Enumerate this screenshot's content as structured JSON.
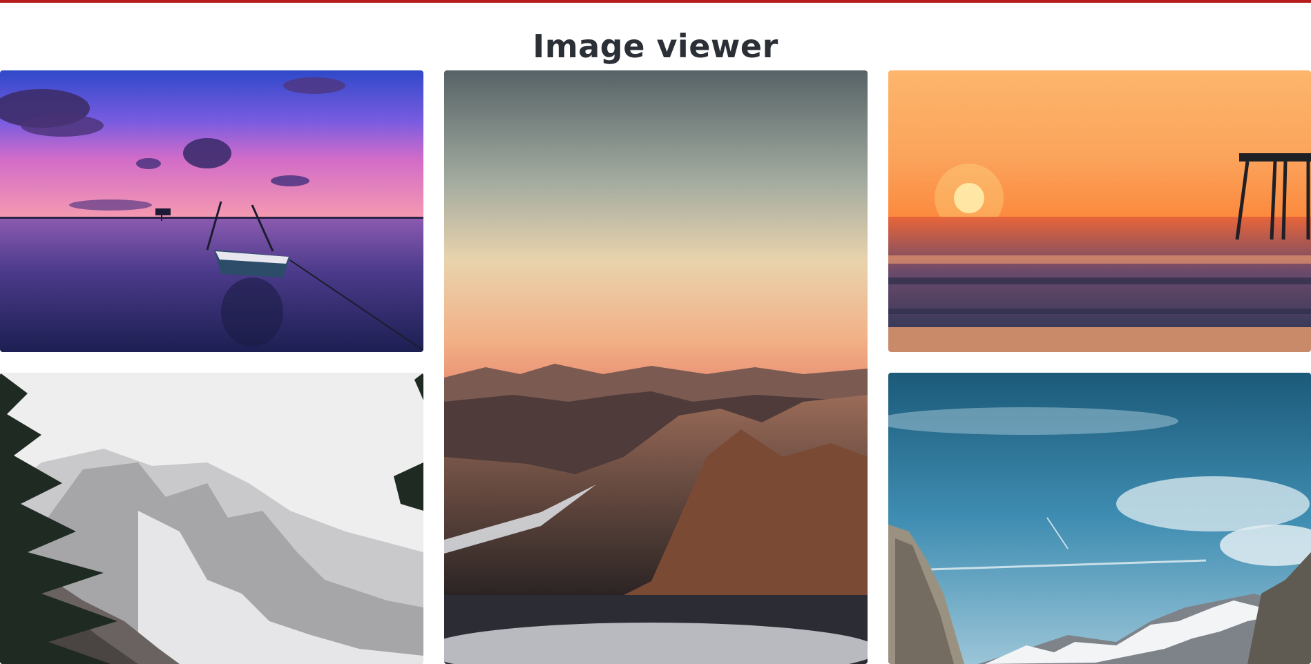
{
  "page": {
    "title": "Image viewer",
    "accent_color": "#b71c1c",
    "title_color": "#2b2f36"
  },
  "gallery": {
    "images": [
      {
        "name": "sunset-lake-boat"
      },
      {
        "name": "mountain-range-dusk"
      },
      {
        "name": "ocean-sunset-pier"
      },
      {
        "name": "snowy-mountain-pines"
      },
      {
        "name": "cliff-blue-sky"
      }
    ]
  }
}
